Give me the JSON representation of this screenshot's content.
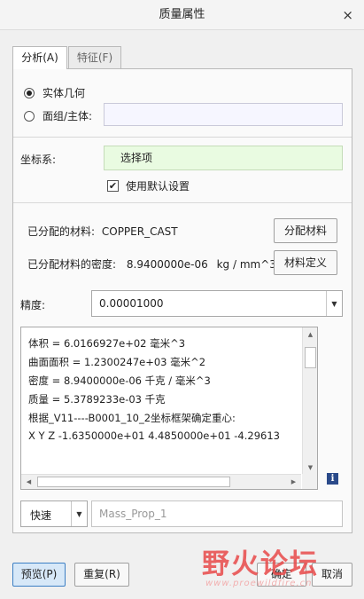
{
  "window": {
    "title": "质量属性",
    "close_label": "×"
  },
  "tabs": [
    {
      "label": "分析(A)",
      "active": true
    },
    {
      "label": "特征(F)",
      "active": false
    }
  ],
  "geometry": {
    "option_solid": "实体几何",
    "option_quilt": "面组/主体:",
    "quilt_value": ""
  },
  "coords": {
    "label": "坐标系:",
    "selection": "选择项",
    "use_default_label": "使用默认设置",
    "use_default_checked": true
  },
  "material": {
    "assigned_label": "已分配的材料:",
    "assigned_value": "COPPER_CAST",
    "assign_button": "分配材料",
    "density_label": "已分配材料的密度:",
    "density_value": "8.9400000e-06",
    "density_unit": "kg / mm^3",
    "define_button": "材料定义"
  },
  "precision": {
    "label": "精度:",
    "value": "0.00001000"
  },
  "results": {
    "lines": [
      "体积 =  6.0166927e+02  毫米^3",
      "曲面面积 =  1.2300247e+03  毫米^2",
      "密度 =  8.9400000e-06 千克 / 毫米^3",
      "质量 =  5.3789233e-03 千克",
      "根据_V11----B0001_10_2坐标框架确定重心:",
      "X   Y   Z    -1.6350000e+01  4.4850000e+01 -4.29613"
    ]
  },
  "mode": {
    "value": "快速",
    "name_placeholder": "Mass_Prop_1"
  },
  "buttons": {
    "preview": "预览(P)",
    "repeat": "重复(R)",
    "ok": "确定",
    "cancel": "取消"
  },
  "watermark": {
    "text": "野火论坛",
    "url": "www.proewildfire.cn"
  },
  "colors": {
    "accent": "#3c7fc4",
    "selection_bg": "#e9fbe1",
    "field_bg": "#f6f6ff",
    "info_icon": "#2a4a8a"
  }
}
